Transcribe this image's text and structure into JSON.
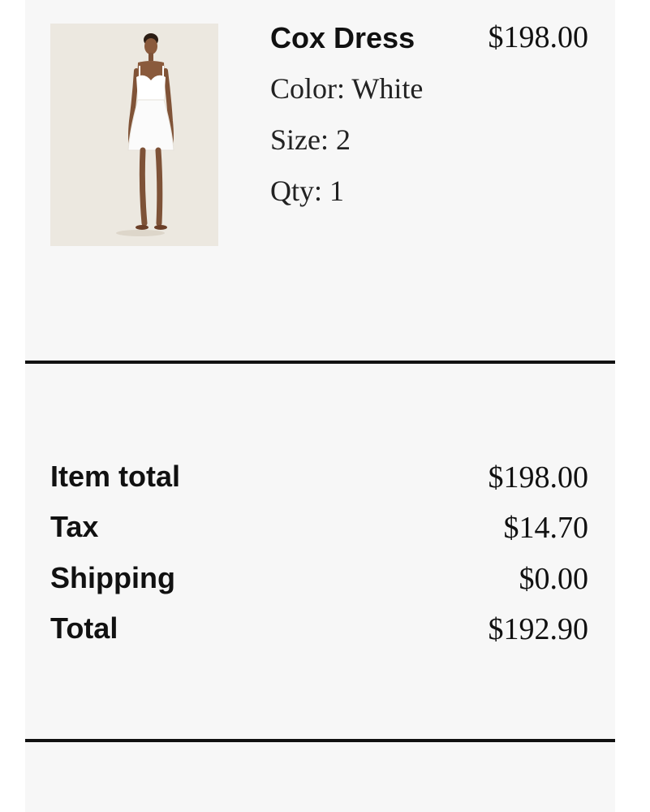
{
  "order_item": {
    "name": "Cox Dress",
    "price": "$198.00",
    "color_line": "Color: White",
    "size_line": "Size: 2",
    "qty_line": "Qty: 1"
  },
  "summary": {
    "rows": [
      {
        "label": "Item total",
        "value": "$198.00"
      },
      {
        "label": "Tax",
        "value": "$14.70"
      },
      {
        "label": "Shipping",
        "value": "$0.00"
      },
      {
        "label": "Total",
        "value": "$192.90"
      }
    ]
  },
  "colors": {
    "panel_background": "#f7f7f7",
    "divider": "#111111",
    "text": "#111111"
  }
}
